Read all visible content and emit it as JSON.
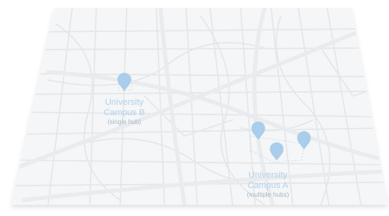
{
  "map": {
    "campus_b": {
      "name_line1": "University",
      "name_line2": "Campus B",
      "note": "(single hub)"
    },
    "campus_a": {
      "name_line1": "University",
      "name_line2": "Campus A",
      "note": "(multiple hubs)"
    },
    "marker_icon": "map-pin-icon",
    "colors": {
      "map_surface": "#f5f6f7",
      "road": "#e2e4e7",
      "major_road": "#e9ebee",
      "pin": "#a9cdea",
      "label": "#b3d1ea",
      "note": "#a9b7c4"
    }
  }
}
